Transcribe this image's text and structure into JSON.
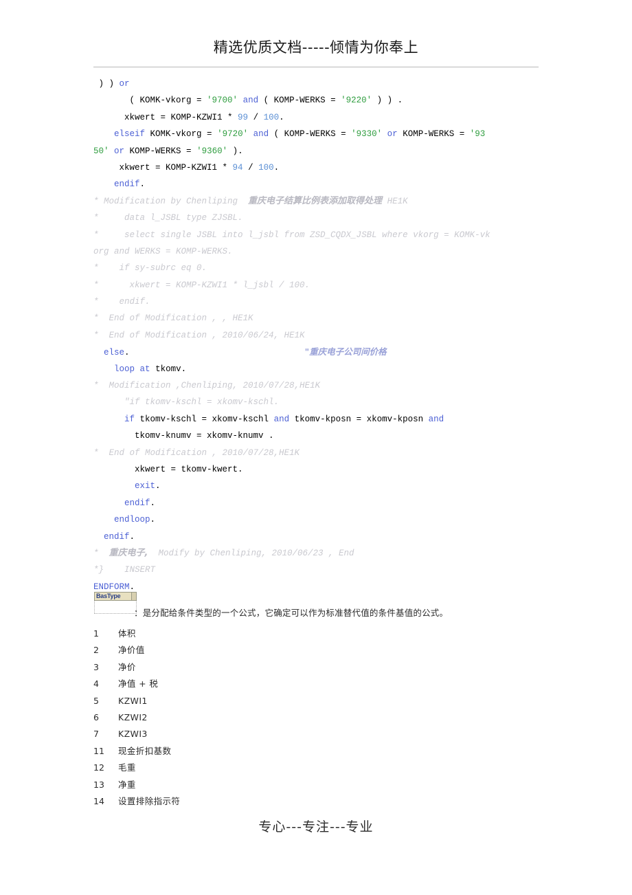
{
  "header": {
    "title": "精选优质文档-----倾情为你奉上"
  },
  "code": {
    "lines": [
      {
        "id": "l01",
        "tokens": [
          {
            "t": "plain",
            "v": " ) ) "
          },
          {
            "t": "kw",
            "v": "or"
          }
        ]
      },
      {
        "id": "l02",
        "tokens": [
          {
            "t": "plain",
            "v": "       ( KOMK-vkorg = "
          },
          {
            "t": "lit",
            "v": "'9700'"
          },
          {
            "t": "plain",
            "v": " "
          },
          {
            "t": "kw",
            "v": "and"
          },
          {
            "t": "plain",
            "v": " ( KOMP-WERKS = "
          },
          {
            "t": "lit",
            "v": "'9220'"
          },
          {
            "t": "plain",
            "v": " ) ) ."
          }
        ]
      },
      {
        "id": "l03",
        "tokens": [
          {
            "t": "plain",
            "v": "      xkwert = KOMP-KZWI1 * "
          },
          {
            "t": "num",
            "v": "99"
          },
          {
            "t": "plain",
            "v": " / "
          },
          {
            "t": "num",
            "v": "100"
          },
          {
            "t": "plain",
            "v": "."
          }
        ]
      },
      {
        "id": "l04",
        "tokens": [
          {
            "t": "plain",
            "v": "    "
          },
          {
            "t": "kw",
            "v": "elseif"
          },
          {
            "t": "plain",
            "v": " KOMK-vkorg = "
          },
          {
            "t": "lit",
            "v": "'9720'"
          },
          {
            "t": "plain",
            "v": " "
          },
          {
            "t": "kw",
            "v": "and"
          },
          {
            "t": "plain",
            "v": " ( KOMP-WERKS = "
          },
          {
            "t": "lit",
            "v": "'9330'"
          },
          {
            "t": "plain",
            "v": " "
          },
          {
            "t": "kw",
            "v": "or"
          },
          {
            "t": "plain",
            "v": " KOMP-WERKS = "
          },
          {
            "t": "lit",
            "v": "'93"
          }
        ]
      },
      {
        "id": "l05",
        "tokens": [
          {
            "t": "lit",
            "v": "50'"
          },
          {
            "t": "plain",
            "v": " "
          },
          {
            "t": "kw",
            "v": "or"
          },
          {
            "t": "plain",
            "v": " KOMP-WERKS = "
          },
          {
            "t": "lit",
            "v": "'9360'"
          },
          {
            "t": "plain",
            "v": " )."
          }
        ]
      },
      {
        "id": "l06",
        "tokens": [
          {
            "t": "plain",
            "v": "     xkwert = KOMP-KZWI1 * "
          },
          {
            "t": "num",
            "v": "94"
          },
          {
            "t": "plain",
            "v": " / "
          },
          {
            "t": "num",
            "v": "100"
          },
          {
            "t": "plain",
            "v": "."
          }
        ]
      },
      {
        "id": "l07",
        "tokens": [
          {
            "t": "plain",
            "v": "    "
          },
          {
            "t": "kw",
            "v": "endif"
          },
          {
            "t": "plain",
            "v": "."
          }
        ]
      },
      {
        "id": "l08",
        "tokens": [
          {
            "t": "cmt",
            "v": "* Modification by Chenliping  "
          },
          {
            "t": "cmtcn",
            "v": "重庆电子结算比例表添加取得处理"
          },
          {
            "t": "cmt",
            "v": " HE1K"
          }
        ]
      },
      {
        "id": "l09",
        "tokens": [
          {
            "t": "cmt",
            "v": "*     data l_JSBL type ZJSBL."
          }
        ]
      },
      {
        "id": "l10",
        "tokens": [
          {
            "t": "cmt",
            "v": "*     select single JSBL into l_jsbl from ZSD_CQDX_JSBL where vkorg = KOMK-vk"
          }
        ]
      },
      {
        "id": "l11",
        "tokens": [
          {
            "t": "cmt",
            "v": "org and WERKS = KOMP-WERKS."
          }
        ]
      },
      {
        "id": "l12",
        "tokens": [
          {
            "t": "cmt",
            "v": "*    if sy-subrc eq 0."
          }
        ]
      },
      {
        "id": "l13",
        "tokens": [
          {
            "t": "cmt",
            "v": "*      xkwert = KOMP-KZWI1 * l_jsbl / 100."
          }
        ]
      },
      {
        "id": "l14",
        "tokens": [
          {
            "t": "cmt",
            "v": "*    endif."
          }
        ]
      },
      {
        "id": "l15",
        "tokens": [
          {
            "t": "cmt",
            "v": "*  End of Modification , , HE1K"
          }
        ]
      },
      {
        "id": "l16",
        "tokens": [
          {
            "t": "cmt",
            "v": "*  End of Modification , 2010/06/24, HE1K"
          }
        ]
      },
      {
        "id": "l17",
        "tokens": [
          {
            "t": "plain",
            "v": "  "
          },
          {
            "t": "kw",
            "v": "else"
          },
          {
            "t": "plain",
            "v": ".                                  "
          },
          {
            "t": "cmtblue",
            "v": "\"重庆电子公司间价格"
          }
        ]
      },
      {
        "id": "l18",
        "tokens": [
          {
            "t": "plain",
            "v": "    "
          },
          {
            "t": "kw",
            "v": "loop"
          },
          {
            "t": "plain",
            "v": " "
          },
          {
            "t": "kw",
            "v": "at"
          },
          {
            "t": "plain",
            "v": " tkomv."
          }
        ]
      },
      {
        "id": "l19",
        "tokens": [
          {
            "t": "cmt",
            "v": "*  Modification ,Chenliping, 2010/07/28,HE1K"
          }
        ]
      },
      {
        "id": "l20",
        "tokens": [
          {
            "t": "cmt",
            "v": "      \"if tkomv-kschl = xkomv-kschl."
          }
        ]
      },
      {
        "id": "l21",
        "tokens": [
          {
            "t": "plain",
            "v": "      "
          },
          {
            "t": "kw",
            "v": "if"
          },
          {
            "t": "plain",
            "v": " tkomv-kschl = xkomv-kschl "
          },
          {
            "t": "kw",
            "v": "and"
          },
          {
            "t": "plain",
            "v": " tkomv-kposn = xkomv-kposn "
          },
          {
            "t": "kw",
            "v": "and"
          }
        ]
      },
      {
        "id": "l22",
        "tokens": [
          {
            "t": "plain",
            "v": "        tkomv-knumv = xkomv-knumv ."
          }
        ]
      },
      {
        "id": "l23",
        "tokens": [
          {
            "t": "cmt",
            "v": "*  End of Modification , 2010/07/28,HE1K"
          }
        ]
      },
      {
        "id": "l24",
        "tokens": [
          {
            "t": "plain",
            "v": "        xkwert = tkomv-kwert."
          }
        ]
      },
      {
        "id": "l25",
        "tokens": [
          {
            "t": "plain",
            "v": "        "
          },
          {
            "t": "kw",
            "v": "exit"
          },
          {
            "t": "plain",
            "v": "."
          }
        ]
      },
      {
        "id": "l26",
        "tokens": [
          {
            "t": "plain",
            "v": "      "
          },
          {
            "t": "kw",
            "v": "endif"
          },
          {
            "t": "plain",
            "v": "."
          }
        ]
      },
      {
        "id": "l27",
        "tokens": [
          {
            "t": "plain",
            "v": "    "
          },
          {
            "t": "kw",
            "v": "endloop"
          },
          {
            "t": "plain",
            "v": "."
          }
        ]
      },
      {
        "id": "l28",
        "tokens": [
          {
            "t": "plain",
            "v": "  "
          },
          {
            "t": "kw",
            "v": "endif"
          },
          {
            "t": "plain",
            "v": "."
          }
        ]
      },
      {
        "id": "l29",
        "tokens": [
          {
            "t": "cmt",
            "v": "*  "
          },
          {
            "t": "cmtcn",
            "v": "重庆电子,"
          },
          {
            "t": "cmt",
            "v": "  Modify by Chenliping, 2010/06/23 , End"
          }
        ]
      },
      {
        "id": "l30",
        "tokens": [
          {
            "t": "cmt",
            "v": "*}    INSERT"
          }
        ]
      },
      {
        "id": "l31",
        "tokens": [
          {
            "t": "endform",
            "v": "ENDFORM"
          },
          {
            "t": "plain",
            "v": "."
          }
        ]
      }
    ]
  },
  "sap_snippet": {
    "column_header": "BasType",
    "cell_value": ""
  },
  "description": "：是分配给条件类型的一个公式，它确定可以作为标准替代值的条件基值的公式。",
  "list": {
    "items": [
      {
        "num": "1",
        "label": "体积"
      },
      {
        "num": "2",
        "label": "净价值"
      },
      {
        "num": "3",
        "label": "净价"
      },
      {
        "num": "4",
        "label": "净值 + 税"
      },
      {
        "num": "5",
        "label": "KZWI1"
      },
      {
        "num": "6",
        "label": "KZWI2"
      },
      {
        "num": "7",
        "label": "KZWI3"
      },
      {
        "num": "11",
        "label": "现金折扣基数"
      },
      {
        "num": "12",
        "label": "毛重"
      },
      {
        "num": "13",
        "label": "净重"
      },
      {
        "num": "14",
        "label": "设置排除指示符"
      }
    ]
  },
  "footer": {
    "text": "专心---专注---专业"
  },
  "colors": {
    "keyword": "#4b5fd4",
    "literal": "#2f9d3f",
    "number": "#5b8fd4",
    "comment": "#c9c9cf",
    "sap_header_bg": "#e8e0c0",
    "sap_header_text": "#2a3f86"
  }
}
